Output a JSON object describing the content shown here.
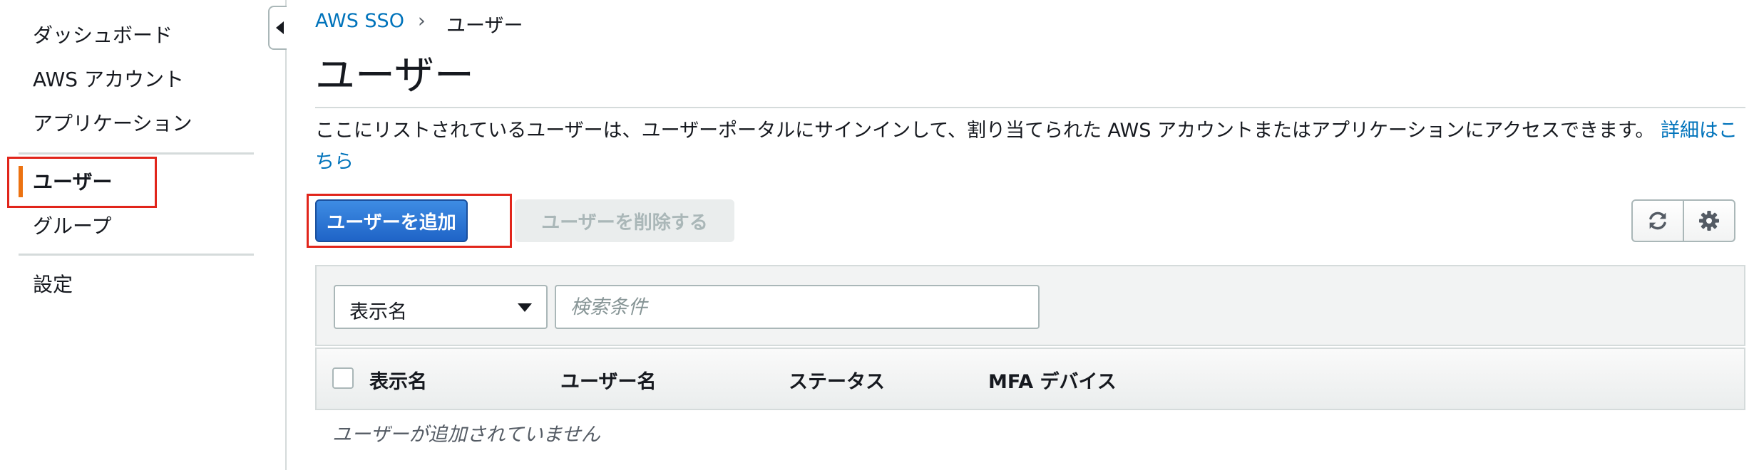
{
  "sidebar": {
    "items": [
      {
        "label": "ダッシュボード"
      },
      {
        "label": "AWS アカウント"
      },
      {
        "label": "アプリケーション"
      },
      {
        "label": "ユーザー"
      },
      {
        "label": "グループ"
      },
      {
        "label": "設定"
      }
    ],
    "active": "ユーザー"
  },
  "breadcrumb": {
    "root": "AWS SSO",
    "separator": "›",
    "current": "ユーザー"
  },
  "page": {
    "title": "ユーザー",
    "description": "ここにリストされているユーザーは、ユーザーポータルにサインインして、割り当てられた AWS アカウントまたはアプリケーションにアクセスできます。",
    "learn_more": "詳細はこちら"
  },
  "toolbar": {
    "add_user": "ユーザーを追加",
    "delete_user": "ユーザーを削除する",
    "icons": [
      "refresh-icon",
      "gear-icon"
    ]
  },
  "filter": {
    "selected": "表示名",
    "search_placeholder": "検索条件"
  },
  "table": {
    "columns": [
      "表示名",
      "ユーザー名",
      "ステータス",
      "MFA デバイス"
    ],
    "empty_message": "ユーザーが追加されていません"
  },
  "colors": {
    "accent": "#ec7211",
    "primary": "#1f64c7",
    "link": "#0073bb",
    "highlight": "#e1251b"
  }
}
